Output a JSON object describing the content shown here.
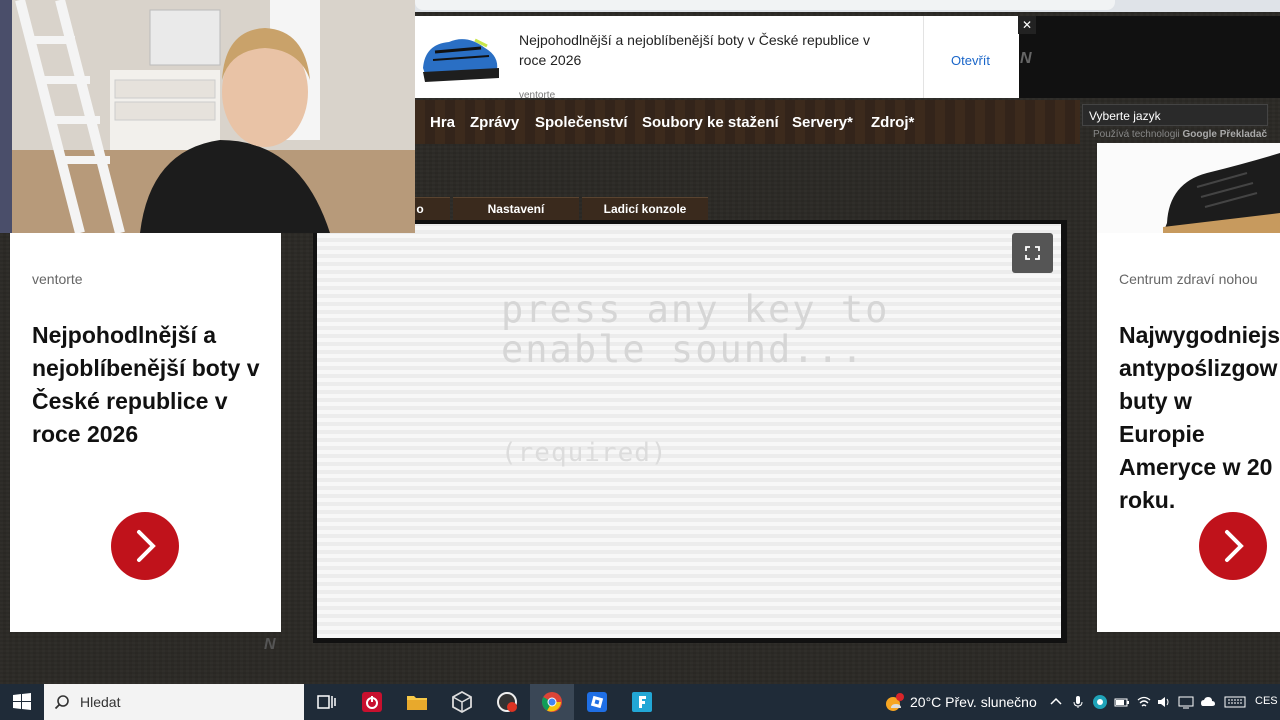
{
  "top_ad": {
    "title": "Nejpohodlnější a nejoblíbenější boty v České republice v roce 2026",
    "source": "ventorte",
    "open_label": "Otevřít",
    "close_label": "✕"
  },
  "nav": {
    "items": [
      {
        "label": "Hra"
      },
      {
        "label": "Zprávy"
      },
      {
        "label": "Společenství"
      },
      {
        "label": "Soubory ke stažení"
      },
      {
        "label": "Servery*"
      },
      {
        "label": "Zdroj*"
      }
    ]
  },
  "language": {
    "select_label": "Vyberte jazyk",
    "powered_prefix": "Používá technologii",
    "powered_brand": "Google",
    "powered_product": "Překladač"
  },
  "tabs": [
    {
      "label": "o"
    },
    {
      "label": "Nastavení"
    },
    {
      "label": "Ladicí konzole"
    }
  ],
  "game": {
    "prompt": "press any key to\nenable sound...",
    "required": "(required)"
  },
  "left_ad": {
    "source": "ventorte",
    "headline": "Nejpohodlnější a nejoblíbenější boty v České republice v roce 2026"
  },
  "right_ad": {
    "source": "Centrum zdraví nohou",
    "headline": "Najwygodniejs antypoślizgow buty w Europie Ameryce w 20 roku."
  },
  "taskbar": {
    "search_placeholder": "Hledat",
    "weather": "20°C  Přev. slunečno",
    "weather_badge": "1",
    "language": "CES",
    "apps": [
      "task-view-icon",
      "power-app-icon",
      "file-explorer-icon",
      "unity-icon",
      "steering-app-icon",
      "chrome-icon",
      "roblox-icon",
      "fortnite-icon"
    ]
  },
  "colors": {
    "accent_red": "#c0121b",
    "link_blue": "#1a66c9",
    "nav_bg": "#3c2a1c",
    "taskbar": "#1f2b38"
  }
}
